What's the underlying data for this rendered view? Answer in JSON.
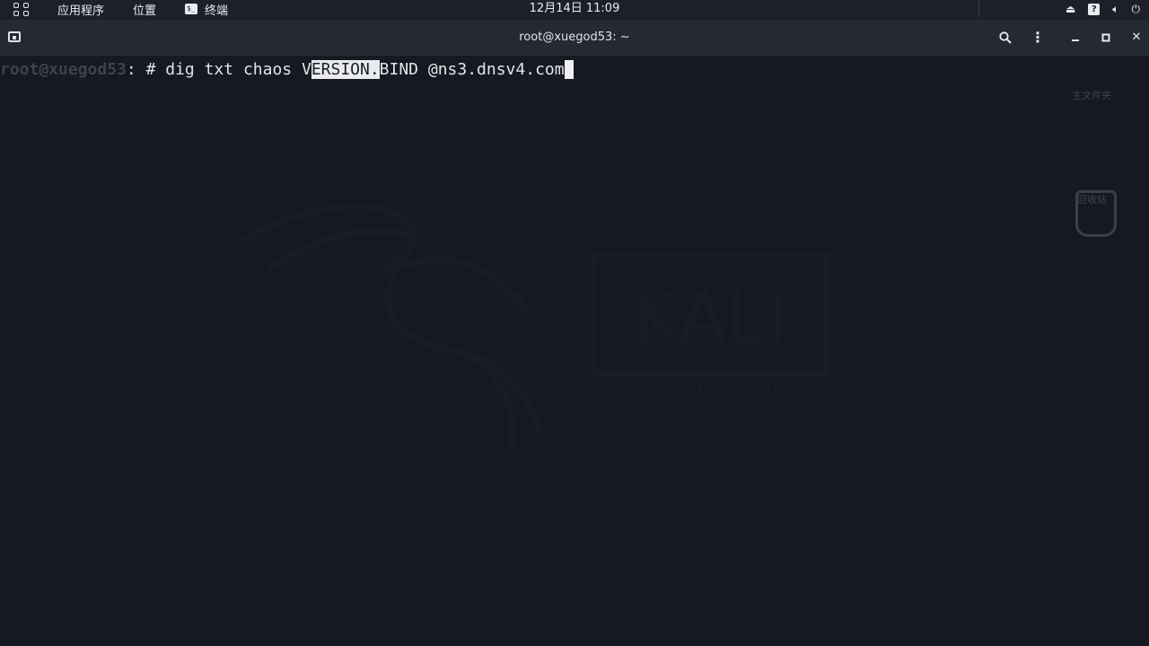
{
  "top_panel": {
    "apps_label": "应用程序",
    "places_label": "位置",
    "terminal_label": "终端",
    "terminal_glyph": "$_",
    "clock": "12月14日  11:09"
  },
  "window": {
    "title": "root@xuegod53: ~"
  },
  "terminal": {
    "prompt": "root@xuegod53",
    "sep": ": # ",
    "cmd_before_sel": "dig txt chaos V",
    "cmd_selected": "ERSION.",
    "cmd_after_sel": "BIND @ns3.dnsv4.com",
    "cursor_char": " "
  },
  "desktop": {
    "home_label": "主文件夹",
    "trash_label": "回收站",
    "wallpaper_brand": "KALI",
    "wallpaper_tagline": "BY OFFENSIVE SECURITY"
  },
  "colors": {
    "background": "#1c1f29",
    "titlebar": "#252934",
    "selection": "#e9ebef"
  }
}
